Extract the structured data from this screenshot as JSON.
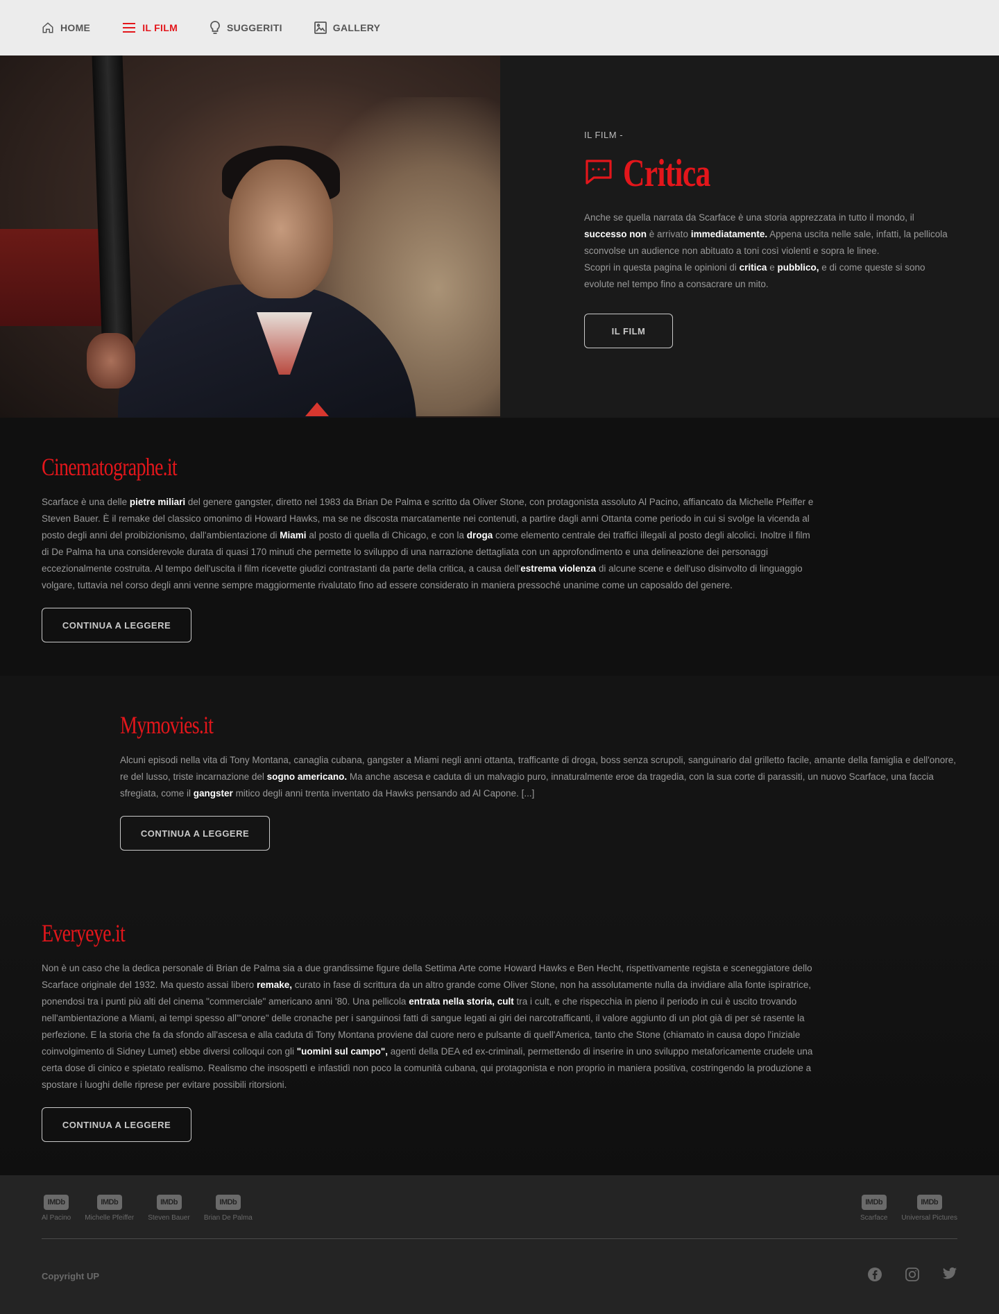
{
  "nav": {
    "items": [
      {
        "label": "HOME",
        "icon": "home-icon"
      },
      {
        "label": "IL FILM",
        "icon": "menu-icon"
      },
      {
        "label": "SUGGERITI",
        "icon": "lightbulb-icon"
      },
      {
        "label": "GALLERY",
        "icon": "image-icon"
      }
    ],
    "active_color": "#e3161b"
  },
  "hero": {
    "kicker": "IL FILM -",
    "title": "Critica",
    "title_icon": "chat-bubble-icon",
    "p1_a": "Anche se quella narrata da Scarface è una storia apprezzata in tutto il mondo, il ",
    "p1_b1": "successo non",
    "p1_c": " è arrivato ",
    "p1_b2": "immediatamente.",
    "p1_d": " Appena uscita nelle sale, infatti, la pellicola sconvolse un audience non abituato a toni così violenti e sopra le linee.",
    "p2_a": "Scopri in questa pagina le opinioni di ",
    "p2_b1": "critica",
    "p2_c": " e ",
    "p2_b2": "pubblico,",
    "p2_d": " e di come queste si sono evolute nel tempo fino a consacrare un mito.",
    "button": "IL FILM"
  },
  "reviews": [
    {
      "source": "Cinematographe.it",
      "t1": "Scarface è una delle ",
      "b1": "pietre miliari",
      "t2": " del genere gangster, diretto nel 1983 da Brian De Palma e scritto da Oliver Stone, con protagonista assoluto Al Pacino, affiancato da Michelle Pfeiffer e Steven Bauer. È il remake del classico omonimo di Howard Hawks, ma se ne discosta marcatamente nei contenuti, a partire dagli anni Ottanta come periodo in cui si svolge la vicenda al posto degli anni del proibizionismo, dall'ambientazione di ",
      "b2": "Miami",
      "t3": " al posto di quella di Chicago, e con la ",
      "b3": "droga",
      "t4": " come elemento centrale dei traffici illegali al posto degli alcolici. Inoltre il film di De Palma ha una considerevole durata di quasi 170 minuti che permette lo sviluppo di una narrazione dettagliata con un approfondimento e una delineazione dei personaggi eccezionalmente costruita. Al tempo dell'uscita il film ricevette giudizi contrastanti da parte della critica, a causa dell'",
      "b4": "estrema violenza",
      "t5": " di alcune scene e dell'uso disinvolto di linguaggio volgare, tuttavia nel corso degli anni venne sempre maggiormente rivalutato fino ad essere considerato in maniera pressoché unanime come un caposaldo del genere.",
      "button": "CONTINUA A LEGGERE"
    },
    {
      "source": "Mymovies.it",
      "t1": "Alcuni episodi nella vita di Tony Montana, canaglia cubana, gangster a Miami negli anni ottanta, trafficante di droga, boss senza scrupoli, sanguinario dal grilletto facile, amante della famiglia e dell'onore, re del lusso, triste incarnazione del ",
      "b1": "sogno americano.",
      "t2": " Ma anche ascesa e caduta di un malvagio puro, innaturalmente eroe da tragedia, con la sua corte di parassiti, un nuovo Scarface, una faccia sfregiata, come il ",
      "b2": "gangster",
      "t3": " mitico degli anni trenta inventato da Hawks pensando ad Al Capone. [...]",
      "button": "CONTINUA A LEGGERE"
    },
    {
      "source": "Everyeye.it",
      "t1": "Non è un caso che la dedica personale di Brian de Palma sia a due grandissime figure della Settima Arte come Howard Hawks e Ben Hecht, rispettivamente regista e sceneggiatore dello Scarface originale del 1932. Ma questo assai libero ",
      "b1": "remake,",
      "t2": " curato in fase di scrittura da un altro grande come Oliver Stone, non ha assolutamente nulla da invidiare alla fonte ispiratrice, ponendosi tra i punti più alti del cinema \"commerciale\" americano anni '80. Una pellicola ",
      "b2": "entrata nella storia, cult",
      "t3": " tra i cult, e che rispecchia in pieno il periodo in cui è uscito trovando nell'ambientazione a Miami, ai tempi spesso all'\"onore\" delle cronache per i sanguinosi fatti di sangue legati ai giri dei narcotrafficanti, il valore aggiunto di un plot già di per sé rasente la perfezione. E la storia che fa da sfondo all'ascesa e alla caduta di Tony Montana proviene dal cuore nero e pulsante di quell'America, tanto che Stone (chiamato in causa dopo l'iniziale coinvolgimento di Sidney Lumet) ebbe diversi colloqui con gli ",
      "b3": "\"uomini sul campo\",",
      "t4": " agenti della DEA ed ex-criminali, permettendo di inserire in uno sviluppo metaforicamente crudele una certa dose di cinico e spietato realismo. Realismo che insospettì e infastidì non poco la comunità cubana, qui protagonista e non proprio in maniera positiva, costringendo la produzione a spostare i luoghi delle riprese per evitare possibili ritorsioni.",
      "button": "CONTINUA A LEGGERE"
    }
  ],
  "footer": {
    "imdb_badge": "IMDb",
    "credits_left": [
      "Al Pacino",
      "Michelle Pfeiffer",
      "Steven Bauer",
      "Brian De Palma"
    ],
    "credits_right": [
      "Scarface",
      "Universal Pictures"
    ],
    "copyright": "Copyright UP",
    "socials": [
      "facebook-icon",
      "instagram-icon",
      "twitter-icon"
    ]
  }
}
